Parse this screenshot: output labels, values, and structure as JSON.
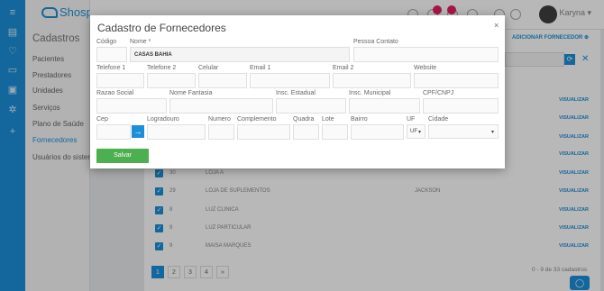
{
  "app": {
    "logo_text": "Shosp",
    "user_name": "Karyna"
  },
  "sidebar": {
    "title": "Cadastros",
    "items": [
      {
        "label": "Pacientes"
      },
      {
        "label": "Prestadores"
      },
      {
        "label": "Unidades"
      },
      {
        "label": "Serviços"
      },
      {
        "label": "Plano de Saúde"
      },
      {
        "label": "Fornecedores"
      },
      {
        "label": "Usuários do sistema"
      }
    ]
  },
  "list": {
    "add_link": "ADICIONAR FORNECEDOR",
    "view_label": "VISUALIZAR",
    "rows": [
      {
        "num": "30",
        "name": "LOJA A",
        "contact": ""
      },
      {
        "num": "29",
        "name": "LOJA DE SUPLEMENTOS",
        "contact": "JACKSON"
      },
      {
        "num": "8",
        "name": "LUZ CLINICA",
        "contact": ""
      },
      {
        "num": "9",
        "name": "LUZ PARTICULAR",
        "contact": ""
      },
      {
        "num": "9",
        "name": "MAISA MARQUES",
        "contact": ""
      }
    ],
    "pages": [
      "1",
      "2",
      "3",
      "4",
      "»"
    ],
    "pager_info": "0 - 9 de 33 cadastros"
  },
  "modal": {
    "title": "Cadastro de Fornecedores",
    "close": "×",
    "labels": {
      "codigo": "Código",
      "nome": "Nome *",
      "pessoa_contato": "Pessoa Contato",
      "telefone1": "Telefone 1",
      "telefone2": "Telefone 2",
      "celular": "Celular",
      "email1": "Email 1",
      "email2": "Email 2",
      "website": "Website",
      "razao_social": "Razao Social",
      "nome_fantasia": "Nome Fantasia",
      "insc_estadual": "Insc. Estadual",
      "insc_municipal": "Insc. Municipal",
      "cpf_cnpj": "CPF/CNPJ",
      "cep": "Cep",
      "logradouro": "Logradouro",
      "numero": "Numero",
      "complemento": "Complemento",
      "quadra": "Quadra",
      "lote": "Lote",
      "bairro": "Bairro",
      "uf": "UF",
      "cidade": "Cidade"
    },
    "values": {
      "nome": "CASAS BAHIA",
      "uf": "UF"
    },
    "save_label": "Salvar"
  }
}
